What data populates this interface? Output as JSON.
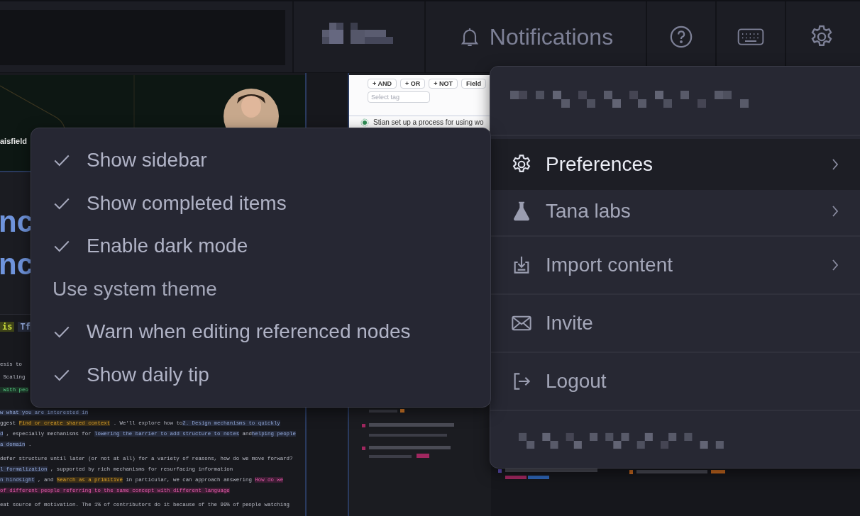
{
  "topbar": {
    "notifications": "Notifications"
  },
  "left_panel": {
    "caption": "aisfield",
    "headings": [
      "nc",
      "nc"
    ],
    "tags": [
      {
        "text": "is",
        "kind": "lime"
      },
      {
        "text": "Tf",
        "kind": "blue"
      }
    ],
    "upper_lines": [
      {
        "segments": [
          {
            "text": "esis to",
            "kind": "plain"
          }
        ]
      },
      {
        "segments": [
          {
            "text": " Scaling",
            "kind": "plain"
          }
        ]
      },
      {
        "segments": [
          {
            "text": " with peo",
            "kind": "green"
          }
        ]
      }
    ],
    "lines": [
      {
        "segments": [
          {
            "text": "w what you are interested in",
            "kind": "blue"
          }
        ]
      },
      {
        "segments": [
          {
            "text": "ggest ",
            "kind": "plain"
          },
          {
            "text": "Find or create shared context",
            "kind": "orange"
          },
          {
            "text": " . We'll explore how to",
            "kind": "plain"
          },
          {
            "text": "2. Design mechanisms to quickly",
            "kind": "blue"
          }
        ]
      },
      {
        "segments": [
          {
            "text": "d",
            "kind": "blue"
          },
          {
            "text": " , especially mechanisms for ",
            "kind": "plain"
          },
          {
            "text": "lowering the barrier to add structure to notes",
            "kind": "blue"
          },
          {
            "text": " and",
            "kind": "plain"
          },
          {
            "text": "helping people",
            "kind": "blue"
          }
        ]
      },
      {
        "segments": [
          {
            "text": "a domain",
            "kind": "blue"
          },
          {
            "text": " .",
            "kind": "plain"
          }
        ]
      },
      {
        "segments": [
          {
            "text": "defer structure until later (or not at all) for a variety of reasons, how do we move forward?",
            "kind": "plain"
          }
        ]
      },
      {
        "segments": [
          {
            "text": "l formalization",
            "kind": "blue"
          },
          {
            "text": " , supported by rich mechanisms for resurfacing information",
            "kind": "plain"
          }
        ]
      },
      {
        "segments": [
          {
            "text": "n hindsight",
            "kind": "blue"
          },
          {
            "text": " , and ",
            "kind": "plain"
          },
          {
            "text": "Search as a primitive",
            "kind": "orange"
          },
          {
            "text": " in particular, we can approach answering ",
            "kind": "plain"
          },
          {
            "text": "How do we",
            "kind": "pink"
          }
        ]
      },
      {
        "segments": [
          {
            "text": "of different people referring to the same concept with different language",
            "kind": "pink"
          }
        ]
      },
      {
        "segments": [
          {
            "text": "eat source of motivation. The 1% of contributors do it because of the 99% of people watching",
            "kind": "plain"
          }
        ]
      }
    ]
  },
  "search_card": {
    "buttons": [
      "+ AND",
      "+ OR",
      "+ NOT"
    ],
    "field_dropdown": "Field",
    "placeholder": "Select tag",
    "row_text": "Stian set up a process for using wo"
  },
  "view_menu": {
    "items": [
      {
        "label": "Show sidebar",
        "checked": true
      },
      {
        "label": "Show completed items",
        "checked": true
      },
      {
        "label": "Enable dark mode",
        "checked": true
      },
      {
        "label": "Use system theme",
        "checked": false
      },
      {
        "label": "Warn when editing referenced nodes",
        "checked": true
      },
      {
        "label": "Show daily tip",
        "checked": true
      }
    ]
  },
  "account_menu": {
    "items": [
      {
        "label": "Preferences",
        "selected": true,
        "submenu": true,
        "divider_after": false
      },
      {
        "label": "Tana labs",
        "selected": false,
        "submenu": true,
        "divider_after": true
      },
      {
        "label": "Import content",
        "selected": false,
        "submenu": true,
        "divider_after": true
      },
      {
        "label": "Invite",
        "selected": false,
        "submenu": false,
        "divider_after": true
      },
      {
        "label": "Logout",
        "selected": false,
        "submenu": false,
        "divider_after": true
      }
    ]
  }
}
